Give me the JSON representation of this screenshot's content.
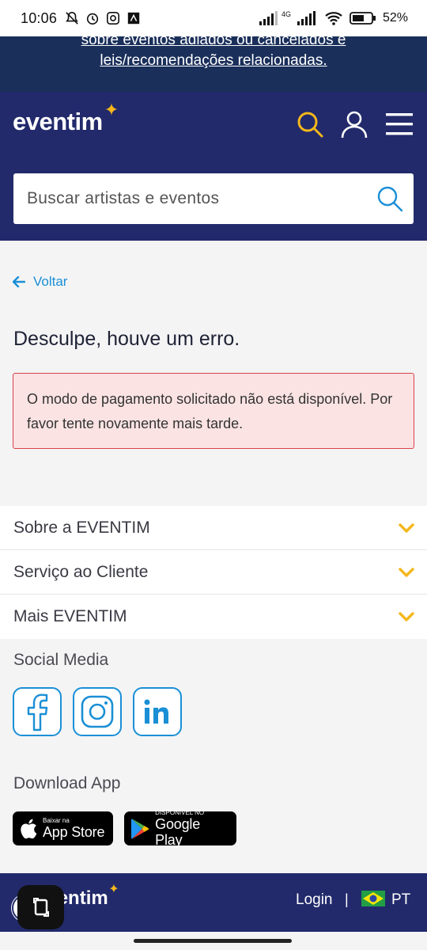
{
  "status_bar": {
    "time": "10:06",
    "network": "4G",
    "battery": "52%"
  },
  "notice": {
    "text": "sobre eventos adiados ou cancelados e leis/recomendações relacionadas."
  },
  "header": {
    "logo": "eventim",
    "search_placeholder": "Buscar artistas e eventos"
  },
  "content": {
    "back_label": "Voltar",
    "error_title": "Desculpe, houve um erro.",
    "error_message": "O modo de pagamento solicitado não está disponível. Por favor tente novamente mais tarde."
  },
  "accordion": {
    "items": [
      {
        "label": "Sobre a EVENTIM"
      },
      {
        "label": "Serviço ao Cliente"
      },
      {
        "label": "Mais EVENTIM"
      }
    ]
  },
  "social": {
    "label": "Social Media",
    "icons": [
      "facebook-icon",
      "instagram-icon",
      "linkedin-icon"
    ]
  },
  "download": {
    "label": "Download App",
    "app_store_small": "Baixar na",
    "app_store_big": "App Store",
    "google_play_small": "DISPONÍVEL NO",
    "google_play_big": "Google Play"
  },
  "footer": {
    "logo": "eventim",
    "login": "Login",
    "separator": "|",
    "language": "PT"
  },
  "colors": {
    "header_bg": "#222a6b",
    "notice_bg": "#1a2f5a",
    "accent_yellow": "#f5b71c",
    "accent_blue": "#1a8fd6",
    "error_bg": "#fbe3e3",
    "error_border": "#d9424a"
  }
}
